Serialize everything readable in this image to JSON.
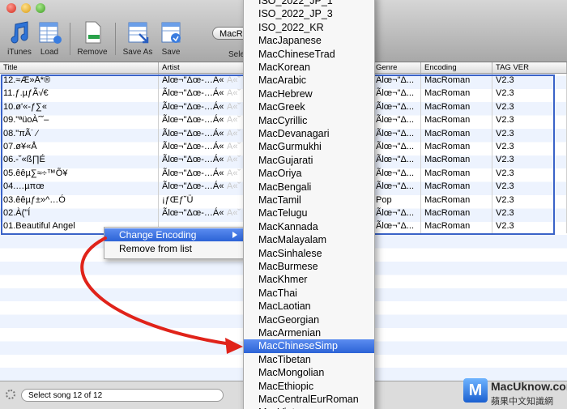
{
  "toolbar": {
    "buttons": [
      {
        "label": "iTunes",
        "icon": "music-note-icon"
      },
      {
        "label": "Load",
        "icon": "load-table-icon"
      },
      {
        "label": "Remove",
        "icon": "remove-document-icon"
      },
      {
        "label": "Save As",
        "icon": "save-as-icon"
      },
      {
        "label": "Save",
        "icon": "save-icon"
      }
    ],
    "encoding_select": "MacR",
    "selector_label": "Sele"
  },
  "table": {
    "headers": [
      "Title",
      "Artist",
      "Genre",
      "Encoding",
      "TAG VER"
    ],
    "rows": [
      {
        "title": "12.≈Æ»Å*®",
        "artist": "Ãlœ¬\"Δœ-…Á«˘",
        "artist_trail": "A«˘ www.TaiHo...",
        "genre": "Ãlœ¬\"Δ...",
        "encoding": "MacRoman",
        "tag": "V2.3"
      },
      {
        "title": "11.ƒ.µƒÃ√€",
        "artist": "Ãlœ¬\"Δœ-…Á«˘",
        "artist_trail": "A«˘ www.TaiHo...",
        "genre": "Ãlœ¬\"Δ...",
        "encoding": "MacRoman",
        "tag": "V2.3"
      },
      {
        "title": "10.ø'«-ƒ∑«",
        "artist": "Ãlœ¬\"Δœ-…Á«˘",
        "artist_trail": "A«˘ www.TaiHo...",
        "genre": "Ãlœ¬\"Δ...",
        "encoding": "MacRoman",
        "tag": "V2.3"
      },
      {
        "title": "09.\"ªüoÀˆ˘–",
        "artist": "Ãlœ¬\"Δœ-…Á«˘",
        "artist_trail": "A«˘ www.TaiHo...",
        "genre": "Ãlœ¬\"Δ...",
        "encoding": "MacRoman",
        "tag": "V2.3"
      },
      {
        "title": "08.\"πÃ˙ ⁄",
        "artist": "Ãlœ¬\"Δœ-…Á«˘",
        "artist_trail": "A«˘ www.TaiHo...",
        "genre": "Ãlœ¬\"Δ...",
        "encoding": "MacRoman",
        "tag": "V2.3"
      },
      {
        "title": "07.ø¥«Å",
        "artist": "Ãlœ¬\"Δœ-…Á«˘",
        "artist_trail": "A«˘ www.TaiHo...",
        "genre": "Ãlœ¬\"Δ...",
        "encoding": "MacRoman",
        "tag": "V2.3"
      },
      {
        "title": "06.-˘«ß∏É",
        "artist": "Ãlœ¬\"Δœ-…Á«˘",
        "artist_trail": "A«˘ www.TaiHo...",
        "genre": "Ãlœ¬\"Δ...",
        "encoding": "MacRoman",
        "tag": "V2.3"
      },
      {
        "title": "05.êêµ∑≈÷™Õ¥",
        "artist": "Ãlœ¬\"Δœ-…Á«˘",
        "artist_trail": "A«˘ www.TaiHo...",
        "genre": "Ãlœ¬\"Δ...",
        "encoding": "MacRoman",
        "tag": "V2.3"
      },
      {
        "title": "04.…µπœ",
        "artist": "Ãlœ¬\"Δœ-…Á«˘",
        "artist_trail": "A«˘ www.TaiHo...",
        "genre": "Ãlœ¬\"Δ...",
        "encoding": "MacRoman",
        "tag": "V2.3"
      },
      {
        "title": "03.êêµƒ±»^…Ó",
        "artist": "¡ƒŒƒ˘Ü",
        "artist_trail": "",
        "genre": "Pop",
        "encoding": "MacRoman",
        "tag": "V2.3"
      },
      {
        "title": "02.À(\"Í",
        "artist": "Ãlœ¬\"Δœ-…Á«˘",
        "artist_trail": "A«˘ www.TaiHo...",
        "genre": "Ãlœ¬\"Δ...",
        "encoding": "MacRoman",
        "tag": "V2.3"
      },
      {
        "title": "01.Beautiful Angel",
        "artist": "",
        "artist_trail": "",
        "genre": "Ãlœ¬\"Δ...",
        "encoding": "MacRoman",
        "tag": "V2.3"
      }
    ]
  },
  "context_menu": {
    "items": [
      "Change Encoding",
      "Remove from list"
    ]
  },
  "encoding_submenu": {
    "items": [
      "ISO_2022_JP_1",
      "ISO_2022_JP_3",
      "ISO_2022_KR",
      "MacJapanese",
      "MacChineseTrad",
      "MacKorean",
      "MacArabic",
      "MacHebrew",
      "MacGreek",
      "MacCyrillic",
      "MacDevanagari",
      "MacGurmukhi",
      "MacGujarati",
      "MacOriya",
      "MacBengali",
      "MacTamil",
      "MacTelugu",
      "MacKannada",
      "MacMalayalam",
      "MacSinhalese",
      "MacBurmese",
      "MacKhmer",
      "MacThai",
      "MacLaotian",
      "MacGeorgian",
      "MacArmenian",
      "MacChineseSimp",
      "MacTibetan",
      "MacMongolian",
      "MacEthiopic",
      "MacCentralEurRoman",
      "MacVietnamese"
    ],
    "highlighted": "MacChineseSimp"
  },
  "status": {
    "text": "Select song 12 of 12"
  },
  "watermark": {
    "site": "MacUknow.com",
    "subtitle": "蘋果中文知識網",
    "logo_letter": "M"
  },
  "colors": {
    "selection": "#3a63c8",
    "highlight": "#2c63d6",
    "arrow": "#e0231a"
  }
}
